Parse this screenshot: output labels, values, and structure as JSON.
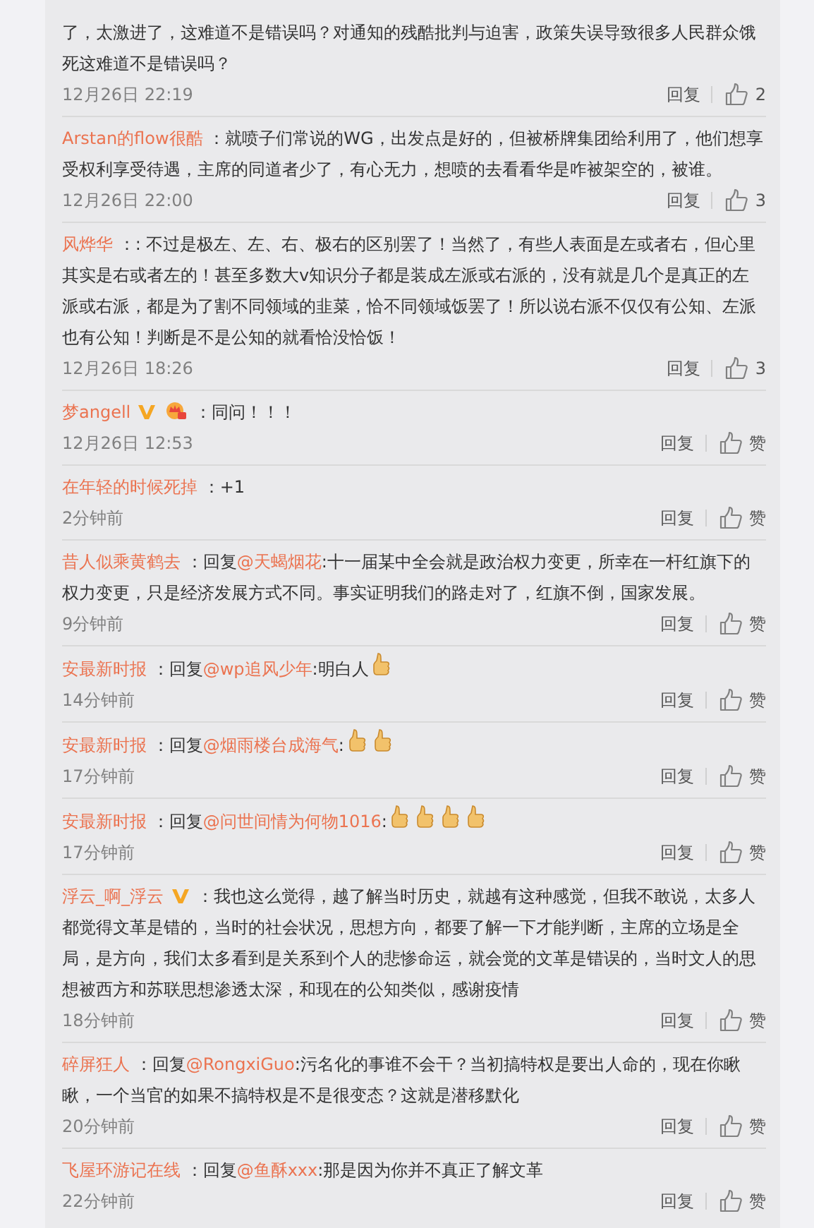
{
  "comments": [
    {
      "text": "了，太激进了，这难道不是错误吗？对通知的残酷批判与迫害，政策失误导致很多人民群众饿死这难道不是错误吗？",
      "time": "12月26日 22:19",
      "reply": "回复",
      "likes": "2"
    },
    {
      "author": "Arstan的flow很酷",
      "text": "：就喷子们常说的WG，出发点是好的，但被桥牌集团给利用了，他们想享受权利享受待遇，主席的同道者少了，有心无力，想喷的去看看华是咋被架空的，被谁。",
      "time": "12月26日 22:00",
      "reply": "回复",
      "likes": "3"
    },
    {
      "author": "风烨华",
      "text": "：: 不过是极左、左、右、极右的区别罢了！当然了，有些人表面是左或者右，但心里其实是右或者左的！甚至多数大v知识分子都是装成左派或右派的，没有就是几个是真正的左派或右派，都是为了割不同领域的韭菜，恰不同领域饭罢了！所以说右派不仅仅有公知、左派也有公知！判断是不是公知的就看恰没恰饭！",
      "time": "12月26日 18:26",
      "reply": "回复",
      "likes": "3"
    },
    {
      "author": "梦angell",
      "verified": true,
      "member_badge": true,
      "text": "：同问！！！",
      "time": "12月26日 12:53",
      "reply": "回复",
      "likes": "赞"
    },
    {
      "author": "在年轻的时候死掉",
      "text": "：+1",
      "time": "2分钟前",
      "reply": "回复",
      "likes": "赞"
    },
    {
      "author": "昔人似乘黄鹤去",
      "prefix": "：回复",
      "reply_to": "@天蝎烟花",
      "text": ":十一届某中全会就是政治权力变更，所幸在一杆红旗下的权力变更，只是经济发展方式不同。事实证明我们的路走对了，红旗不倒，国家发展。",
      "time": "9分钟前",
      "reply": "回复",
      "likes": "赞"
    },
    {
      "author": "安最新时报",
      "prefix": "：回复",
      "reply_to": "@wp追风少年",
      "text": ":明白人",
      "emoji": [
        {
          "kind": "thumbs_up"
        }
      ],
      "time": "14分钟前",
      "reply": "回复",
      "likes": "赞"
    },
    {
      "author": "安最新时报",
      "prefix": "：回复",
      "reply_to": "@烟雨楼台成海气",
      "text": ":",
      "emoji": [
        {
          "kind": "thumbs_up"
        },
        {
          "kind": "thumbs_up"
        }
      ],
      "time": "17分钟前",
      "reply": "回复",
      "likes": "赞"
    },
    {
      "author": "安最新时报",
      "prefix": "：回复",
      "reply_to": "@问世间情为何物1016",
      "text": ":",
      "emoji": [
        {
          "kind": "thumbs_up"
        },
        {
          "kind": "thumbs_up"
        },
        {
          "kind": "thumbs_up"
        },
        {
          "kind": "thumbs_up"
        }
      ],
      "time": "17分钟前",
      "reply": "回复",
      "likes": "赞"
    },
    {
      "author": "浮云_啊_浮云",
      "verified": true,
      "text": "：我也这么觉得，越了解当时历史，就越有这种感觉，但我不敢说，太多人都觉得文革是错的，当时的社会状况，思想方向，都要了解一下才能判断，主席的立场是全局，是方向，我们太多看到是关系到个人的悲惨命运，就会觉的文革是错误的，当时文人的思想被西方和苏联思想渗透太深，和现在的公知类似，感谢疫情",
      "time": "18分钟前",
      "reply": "回复",
      "likes": "赞"
    },
    {
      "author": "碎屏狂人",
      "prefix": "：回复",
      "reply_to": "@RongxiGuo",
      "text": ":污名化的事谁不会干？当初搞特权是要出人命的，现在你瞅瞅，一个当官的如果不搞特权是不是很变态？这就是潜移默化",
      "time": "20分钟前",
      "reply": "回复",
      "likes": "赞"
    },
    {
      "author": "飞屋环游记在线",
      "prefix": "：回复",
      "reply_to": "@鱼酥xxx",
      "text": ":那是因为你并不真正了解文革",
      "time": "22分钟前",
      "reply": "回复",
      "likes": "赞"
    }
  ]
}
